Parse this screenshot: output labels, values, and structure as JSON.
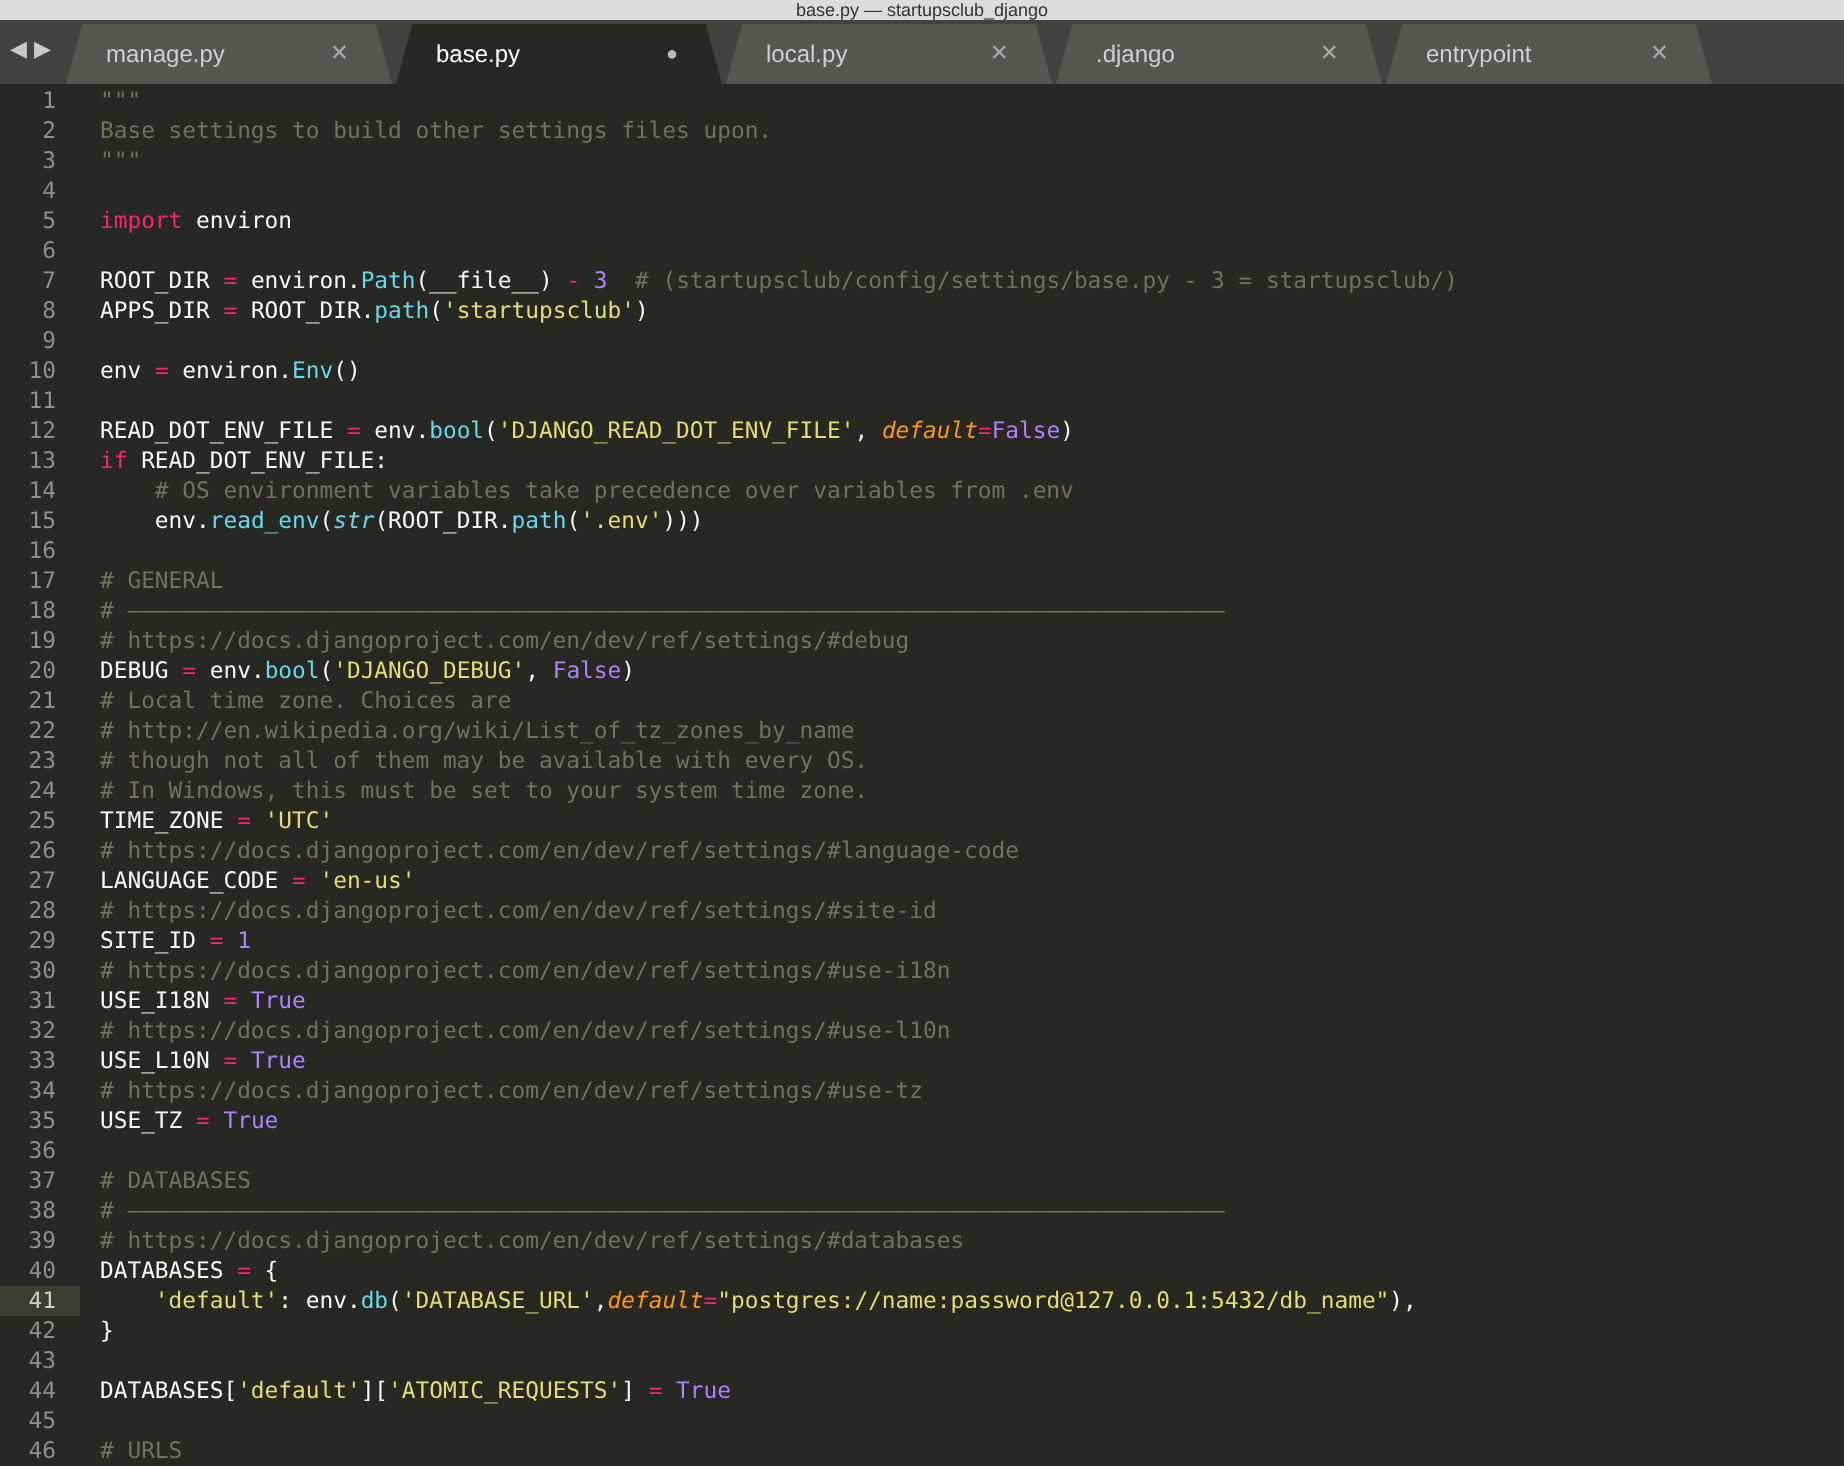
{
  "window": {
    "title": "base.py — startupsclub_django"
  },
  "nav": {
    "back": "◀",
    "forward": "▶"
  },
  "tabs": [
    {
      "label": "manage.py",
      "selected": false,
      "dirty": false,
      "close": "×"
    },
    {
      "label": "base.py",
      "selected": true,
      "dirty": true,
      "close": "●"
    },
    {
      "label": "local.py",
      "selected": false,
      "dirty": false,
      "close": "×"
    },
    {
      "label": ".django",
      "selected": false,
      "dirty": false,
      "close": "×"
    },
    {
      "label": "entrypoint",
      "selected": false,
      "dirty": false,
      "close": "×"
    }
  ],
  "editor": {
    "lines": [
      {
        "number": "1",
        "current": false,
        "tokens": [
          {
            "kind": "comment",
            "text": "\"\"\""
          }
        ]
      },
      {
        "number": "2",
        "current": false,
        "tokens": [
          {
            "kind": "comment",
            "text": "Base settings to build other settings files upon."
          }
        ]
      },
      {
        "number": "3",
        "current": false,
        "tokens": [
          {
            "kind": "comment",
            "text": "\"\"\""
          }
        ]
      },
      {
        "number": "4",
        "current": false
      },
      {
        "number": "5",
        "current": false,
        "tokens": [
          {
            "kind": "keyword",
            "text": "import"
          },
          {
            "kind": "plain",
            "text": " environ"
          }
        ]
      },
      {
        "number": "6",
        "current": false
      },
      {
        "number": "7",
        "current": false,
        "tokens": [
          {
            "kind": "plain",
            "text": "ROOT_DIR "
          },
          {
            "kind": "keyword",
            "text": "="
          },
          {
            "kind": "plain",
            "text": " environ."
          },
          {
            "kind": "func",
            "text": "Path"
          },
          {
            "kind": "plain",
            "text": "(__file__) "
          },
          {
            "kind": "keyword",
            "text": "-"
          },
          {
            "kind": "constant",
            "text": " 3"
          },
          {
            "kind": "comment",
            "text": "  # (startupsclub/config/settings/base.py - 3 = startupsclub/)"
          }
        ]
      },
      {
        "number": "8",
        "current": false,
        "tokens": [
          {
            "kind": "plain",
            "text": "APPS_DIR "
          },
          {
            "kind": "keyword",
            "text": "="
          },
          {
            "kind": "plain",
            "text": " ROOT_DIR."
          },
          {
            "kind": "func",
            "text": "path"
          },
          {
            "kind": "plain",
            "text": "("
          },
          {
            "kind": "string",
            "text": "'startupsclub'"
          },
          {
            "kind": "plain",
            "text": ")"
          }
        ]
      },
      {
        "number": "9",
        "current": false
      },
      {
        "number": "10",
        "current": false,
        "tokens": [
          {
            "kind": "plain",
            "text": "env "
          },
          {
            "kind": "keyword",
            "text": "="
          },
          {
            "kind": "plain",
            "text": " environ."
          },
          {
            "kind": "func",
            "text": "Env"
          },
          {
            "kind": "plain",
            "text": "()"
          }
        ]
      },
      {
        "number": "11",
        "current": false
      },
      {
        "number": "12",
        "current": false,
        "tokens": [
          {
            "kind": "plain",
            "text": "READ_DOT_ENV_FILE "
          },
          {
            "kind": "keyword",
            "text": "="
          },
          {
            "kind": "plain",
            "text": " env."
          },
          {
            "kind": "func",
            "text": "bool"
          },
          {
            "kind": "plain",
            "text": "("
          },
          {
            "kind": "string",
            "text": "'DJANGO_READ_DOT_ENV_FILE'"
          },
          {
            "kind": "plain",
            "text": ", "
          },
          {
            "kind": "param",
            "text": "default"
          },
          {
            "kind": "keyword",
            "text": "="
          },
          {
            "kind": "constant",
            "text": "False"
          },
          {
            "kind": "plain",
            "text": ")"
          }
        ]
      },
      {
        "number": "13",
        "current": false,
        "tokens": [
          {
            "kind": "keyword",
            "text": "if"
          },
          {
            "kind": "plain",
            "text": " READ_DOT_ENV_FILE:"
          }
        ]
      },
      {
        "number": "14",
        "current": false,
        "tokens": [
          {
            "kind": "comment",
            "text": "    # OS environment variables take precedence over variables from .env"
          }
        ]
      },
      {
        "number": "15",
        "current": false,
        "tokens": [
          {
            "kind": "plain",
            "text": "    env."
          },
          {
            "kind": "func",
            "text": "read_env"
          },
          {
            "kind": "plain",
            "text": "("
          },
          {
            "kind": "builtin",
            "text": "str"
          },
          {
            "kind": "plain",
            "text": "(ROOT_DIR."
          },
          {
            "kind": "func",
            "text": "path"
          },
          {
            "kind": "plain",
            "text": "("
          },
          {
            "kind": "string",
            "text": "'.env'"
          },
          {
            "kind": "plain",
            "text": ")))"
          }
        ]
      },
      {
        "number": "16",
        "current": false
      },
      {
        "number": "17",
        "current": false,
        "tokens": [
          {
            "kind": "comment",
            "text": "# GENERAL"
          }
        ]
      },
      {
        "number": "18",
        "current": false,
        "tokens": [
          {
            "kind": "comment",
            "text": "# ————————————————————————————————————————————————————————————————————————————————"
          }
        ]
      },
      {
        "number": "19",
        "current": false,
        "tokens": [
          {
            "kind": "comment",
            "text": "# https://docs.djangoproject.com/en/dev/ref/settings/#debug"
          }
        ]
      },
      {
        "number": "20",
        "current": false,
        "tokens": [
          {
            "kind": "plain",
            "text": "DEBUG "
          },
          {
            "kind": "keyword",
            "text": "="
          },
          {
            "kind": "plain",
            "text": " env."
          },
          {
            "kind": "func",
            "text": "bool"
          },
          {
            "kind": "plain",
            "text": "("
          },
          {
            "kind": "string",
            "text": "'DJANGO_DEBUG'"
          },
          {
            "kind": "plain",
            "text": ", "
          },
          {
            "kind": "constant",
            "text": "False"
          },
          {
            "kind": "plain",
            "text": ")"
          }
        ]
      },
      {
        "number": "21",
        "current": false,
        "tokens": [
          {
            "kind": "comment",
            "text": "# Local time zone. Choices are"
          }
        ]
      },
      {
        "number": "22",
        "current": false,
        "tokens": [
          {
            "kind": "comment",
            "text": "# http://en.wikipedia.org/wiki/List_of_tz_zones_by_name"
          }
        ]
      },
      {
        "number": "23",
        "current": false,
        "tokens": [
          {
            "kind": "comment",
            "text": "# though not all of them may be available with every OS."
          }
        ]
      },
      {
        "number": "24",
        "current": false,
        "tokens": [
          {
            "kind": "comment",
            "text": "# In Windows, this must be set to your system time zone."
          }
        ]
      },
      {
        "number": "25",
        "current": false,
        "tokens": [
          {
            "kind": "plain",
            "text": "TIME_ZONE "
          },
          {
            "kind": "keyword",
            "text": "="
          },
          {
            "kind": "string",
            "text": " 'UTC'"
          }
        ]
      },
      {
        "number": "26",
        "current": false,
        "tokens": [
          {
            "kind": "comment",
            "text": "# https://docs.djangoproject.com/en/dev/ref/settings/#language-code"
          }
        ]
      },
      {
        "number": "27",
        "current": false,
        "tokens": [
          {
            "kind": "plain",
            "text": "LANGUAGE_CODE "
          },
          {
            "kind": "keyword",
            "text": "="
          },
          {
            "kind": "string",
            "text": " 'en-us'"
          }
        ]
      },
      {
        "number": "28",
        "current": false,
        "tokens": [
          {
            "kind": "comment",
            "text": "# https://docs.djangoproject.com/en/dev/ref/settings/#site-id"
          }
        ]
      },
      {
        "number": "29",
        "current": false,
        "tokens": [
          {
            "kind": "plain",
            "text": "SITE_ID "
          },
          {
            "kind": "keyword",
            "text": "="
          },
          {
            "kind": "constant",
            "text": " 1"
          }
        ]
      },
      {
        "number": "30",
        "current": false,
        "tokens": [
          {
            "kind": "comment",
            "text": "# https://docs.djangoproject.com/en/dev/ref/settings/#use-i18n"
          }
        ]
      },
      {
        "number": "31",
        "current": false,
        "tokens": [
          {
            "kind": "plain",
            "text": "USE_I18N "
          },
          {
            "kind": "keyword",
            "text": "="
          },
          {
            "kind": "constant",
            "text": " True"
          }
        ]
      },
      {
        "number": "32",
        "current": false,
        "tokens": [
          {
            "kind": "comment",
            "text": "# https://docs.djangoproject.com/en/dev/ref/settings/#use-l10n"
          }
        ]
      },
      {
        "number": "33",
        "current": false,
        "tokens": [
          {
            "kind": "plain",
            "text": "USE_L10N "
          },
          {
            "kind": "keyword",
            "text": "="
          },
          {
            "kind": "constant",
            "text": " True"
          }
        ]
      },
      {
        "number": "34",
        "current": false,
        "tokens": [
          {
            "kind": "comment",
            "text": "# https://docs.djangoproject.com/en/dev/ref/settings/#use-tz"
          }
        ]
      },
      {
        "number": "35",
        "current": false,
        "tokens": [
          {
            "kind": "plain",
            "text": "USE_TZ "
          },
          {
            "kind": "keyword",
            "text": "="
          },
          {
            "kind": "constant",
            "text": " True"
          }
        ]
      },
      {
        "number": "36",
        "current": false
      },
      {
        "number": "37",
        "current": false,
        "tokens": [
          {
            "kind": "comment",
            "text": "# DATABASES"
          }
        ]
      },
      {
        "number": "38",
        "current": false,
        "tokens": [
          {
            "kind": "comment",
            "text": "# ————————————————————————————————————————————————————————————————————————————————"
          }
        ]
      },
      {
        "number": "39",
        "current": false,
        "tokens": [
          {
            "kind": "comment",
            "text": "# https://docs.djangoproject.com/en/dev/ref/settings/#databases"
          }
        ]
      },
      {
        "number": "40",
        "current": false,
        "tokens": [
          {
            "kind": "plain",
            "text": "DATABASES "
          },
          {
            "kind": "keyword",
            "text": "="
          },
          {
            "kind": "plain",
            "text": " {"
          }
        ]
      },
      {
        "number": "41",
        "current": true,
        "tokens": [
          {
            "kind": "string",
            "text": "    'default'"
          },
          {
            "kind": "plain",
            "text": ": env."
          },
          {
            "kind": "func",
            "text": "db"
          },
          {
            "kind": "plain",
            "text": "("
          },
          {
            "kind": "string",
            "text": "'DATABASE_URL'"
          },
          {
            "kind": "plain",
            "text": ","
          },
          {
            "kind": "param",
            "text": "default"
          },
          {
            "kind": "keyword",
            "text": "="
          },
          {
            "kind": "string",
            "text": "\"postgres://name:password@127.0.0.1:5432/db_name\""
          },
          {
            "kind": "plain",
            "text": "),"
          }
        ]
      },
      {
        "number": "42",
        "current": false,
        "tokens": [
          {
            "kind": "plain",
            "text": "}"
          }
        ]
      },
      {
        "number": "43",
        "current": false
      },
      {
        "number": "44",
        "current": false,
        "tokens": [
          {
            "kind": "plain",
            "text": "DATABASES["
          },
          {
            "kind": "string",
            "text": "'default'"
          },
          {
            "kind": "plain",
            "text": "]["
          },
          {
            "kind": "string",
            "text": "'ATOMIC_REQUESTS'"
          },
          {
            "kind": "plain",
            "text": "] "
          },
          {
            "kind": "keyword",
            "text": "="
          },
          {
            "kind": "constant",
            "text": " True"
          }
        ]
      },
      {
        "number": "45",
        "current": false
      },
      {
        "number": "46",
        "current": false,
        "tokens": [
          {
            "kind": "comment",
            "text": "# URLS"
          }
        ]
      }
    ]
  }
}
